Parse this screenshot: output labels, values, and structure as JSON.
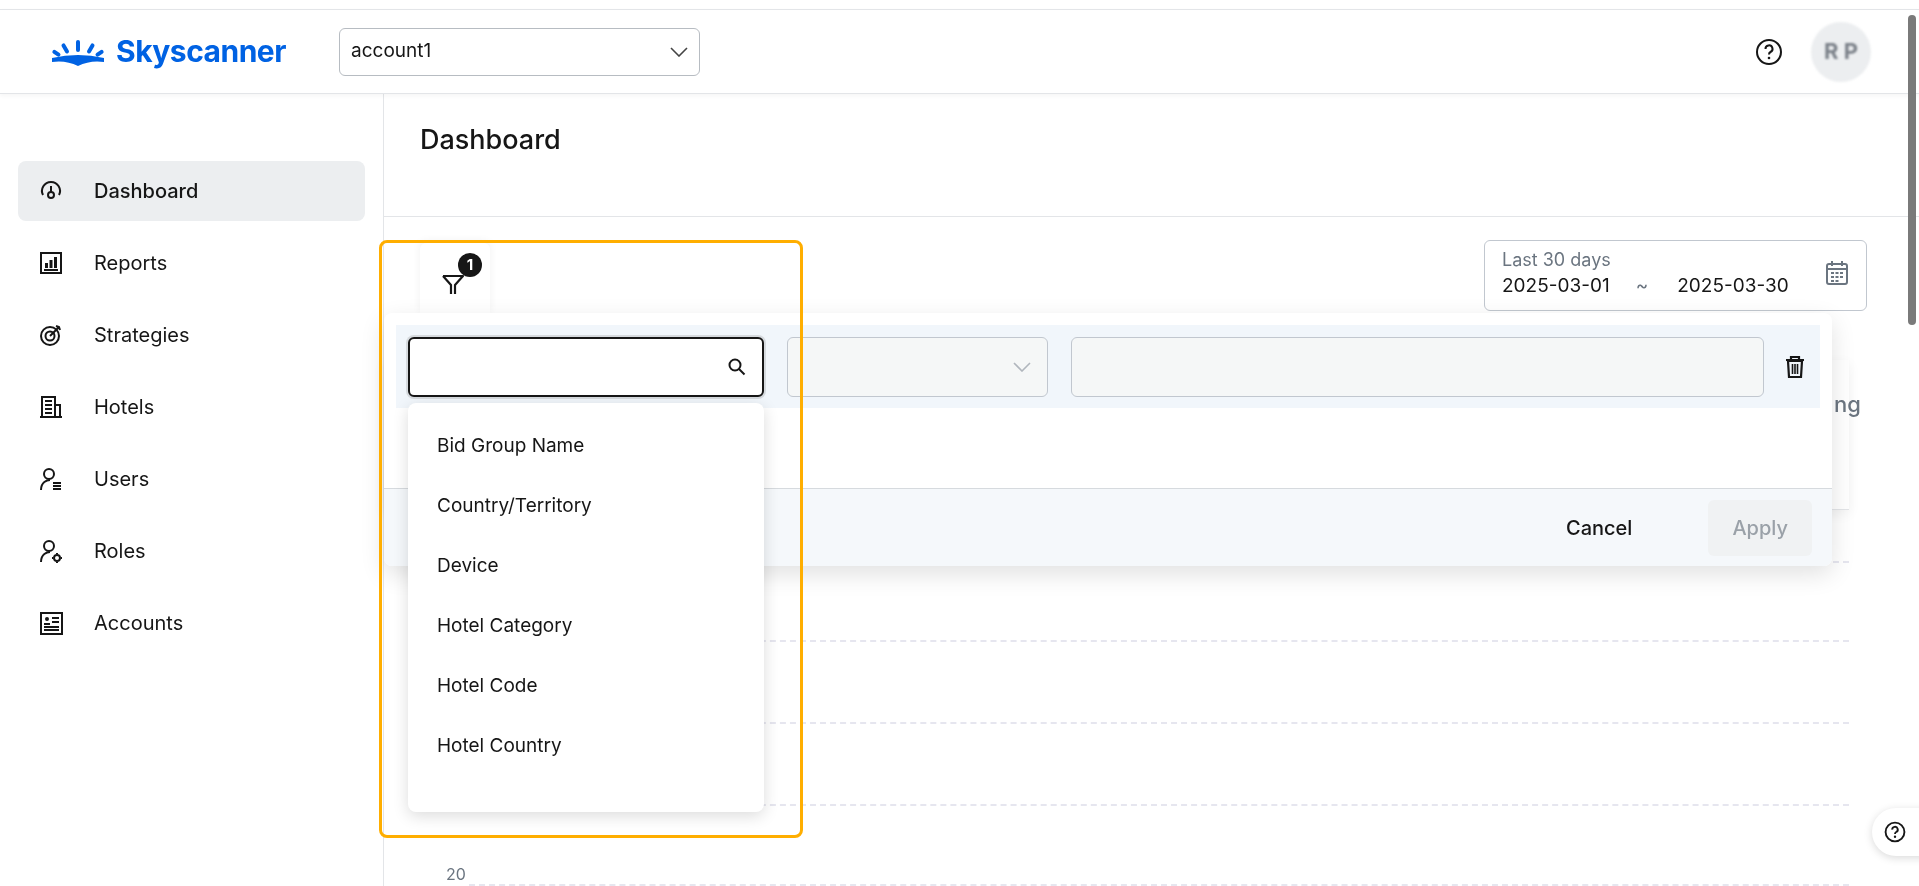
{
  "header": {
    "logo": "Skyscanner",
    "account_select": {
      "value": "account1"
    },
    "avatar": "R P"
  },
  "sidebar": {
    "items": [
      {
        "label": "Dashboard",
        "kind": "gauge",
        "selected": true
      },
      {
        "label": "Reports",
        "kind": "report",
        "selected": false
      },
      {
        "label": "Strategies",
        "kind": "target",
        "selected": false
      },
      {
        "label": "Hotels",
        "kind": "building",
        "selected": false
      },
      {
        "label": "Users",
        "kind": "userlist",
        "selected": false
      },
      {
        "label": "Roles",
        "kind": "usergear",
        "selected": false
      },
      {
        "label": "Accounts",
        "kind": "card",
        "selected": false
      }
    ]
  },
  "page_title": "Dashboard",
  "filter": {
    "badge": "1",
    "focused": true,
    "options": [
      "Bid Group Name",
      "Country/Territory",
      "Device",
      "Hotel Category",
      "Hotel Code",
      "Hotel Country"
    ],
    "buttons": [
      {
        "label": "Cancel",
        "disabled": false
      },
      {
        "label": "Apply",
        "disabled": true
      }
    ]
  },
  "date_range": {
    "label": "Last 30 days",
    "start": "2025-03-01",
    "separator": "~",
    "end": "2025-03-30"
  },
  "chart_card": {
    "title_fragment": "ng",
    "y_tick": "20"
  }
}
